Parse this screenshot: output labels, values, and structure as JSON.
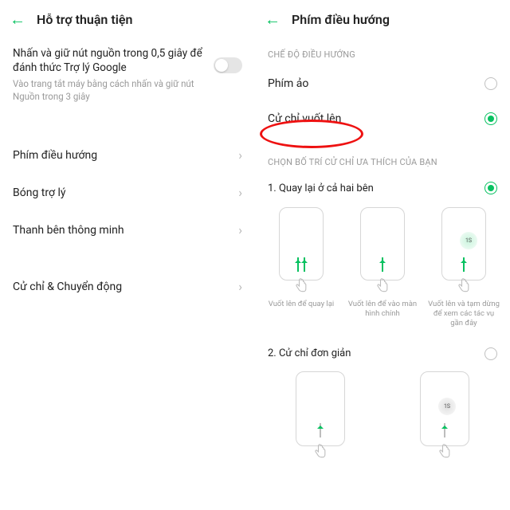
{
  "left": {
    "title": "Hỗ trợ thuận tiện",
    "assistant": {
      "label": "Nhấn và giữ nút nguồn trong 0,5 giây để đánh thức Trợ lý Google",
      "desc": "Vào trang tắt máy bằng cách nhấn và giữ nút Nguồn trong 3 giây"
    },
    "items": [
      "Phím điều hướng",
      "Bóng trợ lý",
      "Thanh bên thông minh"
    ],
    "gestures_item": "Cử chỉ & Chuyển động"
  },
  "right": {
    "title": "Phím điều hướng",
    "mode_header": "CHẾ ĐỘ ĐIỀU HƯỚNG",
    "modes": [
      {
        "label": "Phím ảo",
        "checked": false
      },
      {
        "label": "Cử chỉ vuốt lên",
        "checked": true
      }
    ],
    "layout_header": "CHỌN BỐ TRÍ CỬ CHỈ ƯA THÍCH CỦA BẠN",
    "option1": {
      "label": "1. Quay lại ở cả hai bên",
      "checked": true
    },
    "gestures1": [
      "Vuốt lên để quay lại",
      "Vuốt lên để vào màn hình chính",
      "Vuốt lên và tạm dừng để xem các tác vụ gần đây"
    ],
    "option2": {
      "label": "2. Cử chỉ đơn giản",
      "checked": false
    },
    "badge": "1S"
  }
}
